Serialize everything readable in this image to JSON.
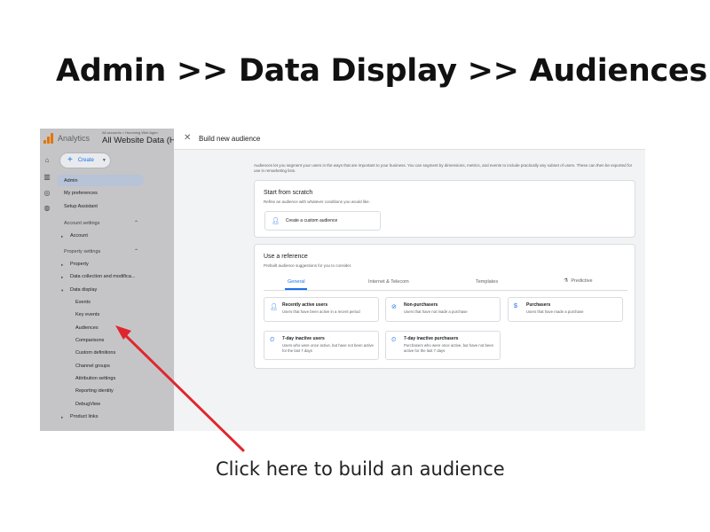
{
  "headline": "Admin >> Data Display >> Audiences",
  "caption": "Click here to build an audience",
  "colors": {
    "arrow": "#e0262d",
    "accent": "#1a73e8",
    "sidebar_dim": "#c5c5c7"
  },
  "app": {
    "name": "Analytics",
    "account_crumb": "All accounts > Humming Web Agen",
    "account_name": "All Website Data (Hu",
    "create_label": "Create",
    "rail_icons": [
      "home-icon",
      "reports-icon",
      "explore-icon",
      "advertising-icon"
    ]
  },
  "sidebar": {
    "admin": "Admin",
    "my_preferences": "My preferences",
    "setup_assistant": "Setup Assistant",
    "account_settings": "Account settings",
    "account": "Account",
    "property_settings": "Property settings",
    "property": "Property",
    "data_collection": "Data collection and modifica...",
    "data_display": "Data display",
    "data_display_items": [
      "Events",
      "Key events",
      "Audiences",
      "Comparisons",
      "Custom definitions",
      "Channel groups",
      "Attribution settings",
      "Reporting identity",
      "DebugView"
    ],
    "product_links": "Product links"
  },
  "panel": {
    "title": "Build new audience",
    "intro": "Audiences let you segment your users in the ways that are important to your business. You can segment by dimensions, metrics, and events to include practically any subset of users. These can then be exported for use in remarketing lists.",
    "scratch": {
      "title": "Start from scratch",
      "subtitle": "Refine an audience with whatever conditions you would like.",
      "button": "Create a custom audience"
    },
    "reference": {
      "title": "Use a reference",
      "subtitle": "Prebuilt audience suggestions for you to consider.",
      "tabs": [
        "General",
        "Internet & Telecom",
        "Templates",
        "Predictive"
      ],
      "active_tab": "General",
      "tiles": [
        {
          "title": "Recently active users",
          "desc": "Users that have been active in a recent period",
          "icon": "person-icon"
        },
        {
          "title": "Non-purchasers",
          "desc": "Users that have not made a purchase",
          "icon": "no-purchase-icon"
        },
        {
          "title": "Purchasers",
          "desc": "Users that have made a purchase",
          "icon": "dollar-icon"
        },
        {
          "title": "7-day inactive users",
          "desc": "Users who were once active, but have not been active for the last 7 days",
          "icon": "inactive-clock-icon"
        },
        {
          "title": "7-day inactive purchasers",
          "desc": "Purchasers who were once active, but have not been active for the last 7 days",
          "icon": "inactive-clock-icon"
        }
      ]
    }
  }
}
